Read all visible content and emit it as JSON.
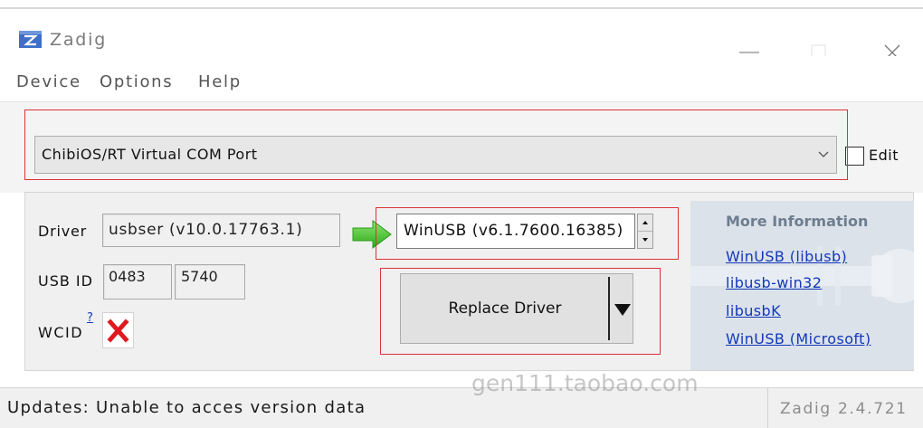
{
  "window": {
    "title": "Zadig",
    "icon": "zadig-app-icon",
    "controls": [
      "minimize-icon",
      "maximize-icon",
      "close-icon"
    ]
  },
  "menu": {
    "items": [
      "Device",
      "Options",
      "Help"
    ]
  },
  "device": {
    "selected": "ChibiOS/RT Virtual COM Port",
    "dropdown_icon": "chevron-down-icon",
    "edit_label": "Edit",
    "edit_checked": false
  },
  "driver": {
    "label": "Driver",
    "current": "usbser (v10.0.17763.1)",
    "arrow_icon": "green-arrow-right-icon",
    "target": "WinUSB (v6.1.7600.16385)"
  },
  "usb_id": {
    "label": "USB ID",
    "vid": "0483",
    "pid": "5740"
  },
  "wcid": {
    "label": "WCID",
    "help_link": "?",
    "status_icon": "red-x-icon"
  },
  "action": {
    "label": "Replace Driver",
    "split_icon": "triangle-down-icon"
  },
  "more_info": {
    "heading": "More Information",
    "links": [
      "WinUSB (libusb)",
      "libusb-win32",
      "libusbK",
      "WinUSB (Microsoft)"
    ]
  },
  "status_bar": {
    "message": "Updates: Unable to acces version data",
    "version": "Zadig 2.4.721"
  },
  "watermark": "gen111.taobao.com",
  "colors": {
    "annotation_red": "#d8343a",
    "link_blue": "#1438b8",
    "arrow_green": "#3cc221",
    "error_red": "#e0191f",
    "info_panel": "#dbe2ea"
  }
}
